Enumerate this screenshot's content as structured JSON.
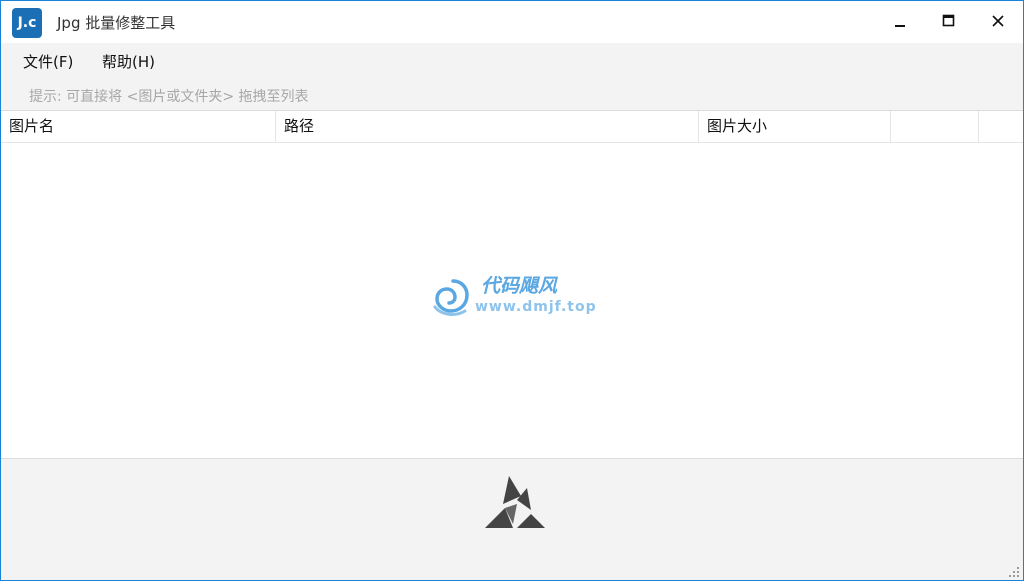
{
  "window": {
    "title": "Jpg 批量修整工具",
    "app_icon_text": "J.c",
    "accent_color": "#1883d7",
    "icon_color": "#1a6fb5"
  },
  "menu": {
    "items": [
      {
        "label": "文件(F)"
      },
      {
        "label": "帮助(H)"
      }
    ]
  },
  "hint": "提示: 可直接将 <图片或文件夹> 拖拽至列表",
  "table": {
    "columns": [
      "图片名",
      "路径",
      "图片大小",
      "",
      ""
    ]
  },
  "watermark": {
    "line1": "代码飓风",
    "line2": "www.dmjf.top"
  },
  "icons": {
    "minimize": "minimize-icon",
    "maximize": "maximize-icon",
    "close": "close-icon",
    "logo": "triangle-logo-icon",
    "grip": "resize-grip-icon"
  }
}
